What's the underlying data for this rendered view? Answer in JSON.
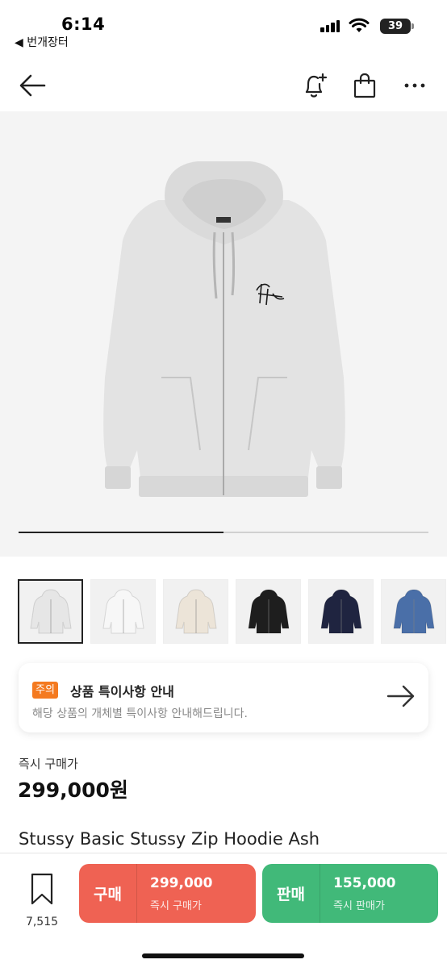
{
  "status_bar": {
    "time": "6:14",
    "back_app": "◀ 번개장터",
    "battery": "39"
  },
  "nav": {
    "back_icon": "arrow-left-icon",
    "alert_icon": "bell-plus-icon",
    "bag_icon": "shopping-bag-icon",
    "more_icon": "more-icon"
  },
  "gallery": {
    "progress": 0.5,
    "thumbnails": [
      {
        "color": "#e6e6e6",
        "selected": true
      },
      {
        "color": "#f7f7f7",
        "selected": false
      },
      {
        "color": "#ece4d8",
        "selected": false
      },
      {
        "color": "#1e1e1e",
        "selected": false
      },
      {
        "color": "#1f2440",
        "selected": false
      },
      {
        "color": "#4a6fa8",
        "selected": false
      }
    ]
  },
  "notice": {
    "badge": "주의",
    "title": "상품 특이사항 안내",
    "description": "해당 상품의 개체별 특이사항 안내해드립니다."
  },
  "price": {
    "label": "즉시 구매가",
    "value": "299,000원"
  },
  "product": {
    "name": "Stussy Basic Stussy Zip Hoodie Ash"
  },
  "bottom_bar": {
    "bookmark_count": "7,515",
    "buy": {
      "kind": "구매",
      "amount": "299,000",
      "sub": "즉시 구매가"
    },
    "sell": {
      "kind": "판매",
      "amount": "155,000",
      "sub": "즉시 판매가"
    }
  },
  "colors": {
    "buy": "#ef6253",
    "sell": "#41b979",
    "badge": "#f47a20"
  }
}
